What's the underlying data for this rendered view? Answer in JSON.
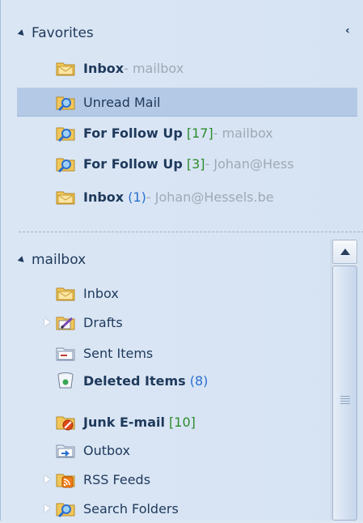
{
  "navigation": {
    "collapse_glyph": "‹",
    "favorites": {
      "header": "Favorites",
      "items": [
        {
          "name": "Inbox",
          "count": "",
          "suffix": " - mailbox",
          "bold": true,
          "icon": "inbox-folder-icon",
          "selected": false
        },
        {
          "name": "Unread Mail",
          "count": "",
          "suffix": "",
          "bold": false,
          "icon": "search-folder-icon",
          "selected": true
        },
        {
          "name": "For Follow Up",
          "count": "[17]",
          "suffix": " - mailbox",
          "bold": true,
          "icon": "search-folder-icon",
          "selected": false
        },
        {
          "name": "For Follow Up",
          "count": "[3]",
          "suffix": " - Johan@Hess",
          "bold": true,
          "icon": "search-folder-icon",
          "selected": false
        },
        {
          "name": "Inbox",
          "count": "(1)",
          "suffix": " - Johan@Hessels.be",
          "bold": true,
          "icon": "inbox-folder-icon",
          "selected": false
        }
      ]
    },
    "mailbox": {
      "header": "mailbox",
      "items": [
        {
          "name": "Inbox",
          "count": "",
          "icon": "inbox-folder-icon",
          "expandable": false,
          "bold": false
        },
        {
          "name": "Drafts",
          "count": "",
          "icon": "drafts-folder-icon",
          "expandable": true,
          "bold": false
        },
        {
          "name": "Sent Items",
          "count": "",
          "icon": "sent-items-icon",
          "expandable": false,
          "bold": false
        },
        {
          "name": "Deleted Items",
          "count": "(8)",
          "icon": "deleted-items-icon",
          "expandable": false,
          "bold": true
        },
        {
          "name": "Junk E-mail",
          "count": "[10]",
          "icon": "junk-email-icon",
          "expandable": false,
          "bold": true
        },
        {
          "name": "Outbox",
          "count": "",
          "icon": "outbox-icon",
          "expandable": false,
          "bold": false
        },
        {
          "name": "RSS Feeds",
          "count": "",
          "icon": "rss-feeds-icon",
          "expandable": true,
          "bold": false
        },
        {
          "name": "Search Folders",
          "count": "",
          "icon": "search-folder-icon",
          "expandable": true,
          "bold": false
        }
      ]
    }
  },
  "colors": {
    "accent": "#1e395b",
    "selected": "#b4c9e5",
    "count_blue": "#2a6fcf",
    "count_green": "#2c8b2c",
    "muted": "#a0a9b5"
  }
}
